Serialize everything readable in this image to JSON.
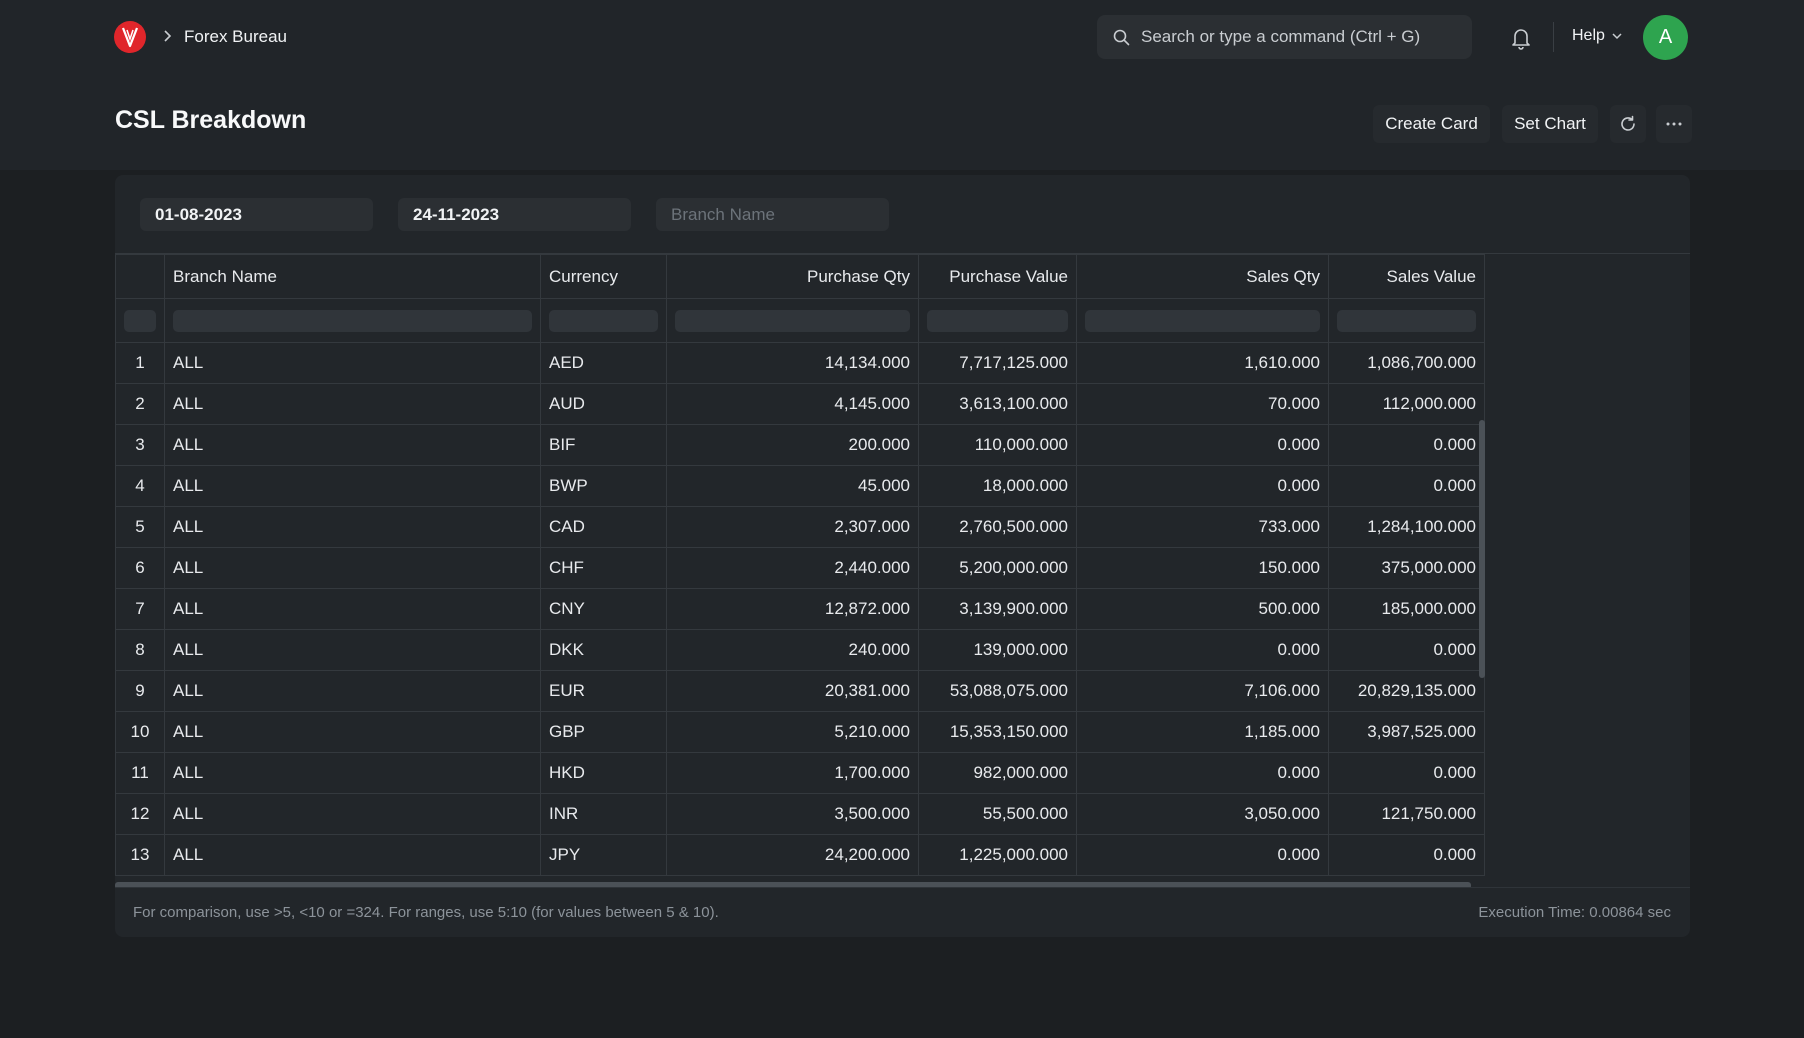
{
  "navbar": {
    "breadcrumb": "Forex Bureau",
    "search_placeholder": "Search or type a command (Ctrl + G)",
    "help_label": "Help",
    "avatar_letter": "A"
  },
  "page": {
    "title": "CSL Breakdown",
    "actions": {
      "create_card": "Create Card",
      "set_chart": "Set Chart"
    }
  },
  "filters": {
    "from_date": "01-08-2023",
    "to_date": "24-11-2023",
    "branch_placeholder": "Branch Name"
  },
  "table": {
    "columns": [
      "Branch Name",
      "Currency",
      "Purchase Qty",
      "Purchase Value",
      "Sales Qty",
      "Sales Value"
    ],
    "rows": [
      {
        "idx": "1",
        "branch": "ALL",
        "currency": "AED",
        "purchase_qty": "14,134.000",
        "purchase_value": "7,717,125.000",
        "sales_qty": "1,610.000",
        "sales_value": "1,086,700.000"
      },
      {
        "idx": "2",
        "branch": "ALL",
        "currency": "AUD",
        "purchase_qty": "4,145.000",
        "purchase_value": "3,613,100.000",
        "sales_qty": "70.000",
        "sales_value": "112,000.000"
      },
      {
        "idx": "3",
        "branch": "ALL",
        "currency": "BIF",
        "purchase_qty": "200.000",
        "purchase_value": "110,000.000",
        "sales_qty": "0.000",
        "sales_value": "0.000"
      },
      {
        "idx": "4",
        "branch": "ALL",
        "currency": "BWP",
        "purchase_qty": "45.000",
        "purchase_value": "18,000.000",
        "sales_qty": "0.000",
        "sales_value": "0.000"
      },
      {
        "idx": "5",
        "branch": "ALL",
        "currency": "CAD",
        "purchase_qty": "2,307.000",
        "purchase_value": "2,760,500.000",
        "sales_qty": "733.000",
        "sales_value": "1,284,100.000"
      },
      {
        "idx": "6",
        "branch": "ALL",
        "currency": "CHF",
        "purchase_qty": "2,440.000",
        "purchase_value": "5,200,000.000",
        "sales_qty": "150.000",
        "sales_value": "375,000.000"
      },
      {
        "idx": "7",
        "branch": "ALL",
        "currency": "CNY",
        "purchase_qty": "12,872.000",
        "purchase_value": "3,139,900.000",
        "sales_qty": "500.000",
        "sales_value": "185,000.000"
      },
      {
        "idx": "8",
        "branch": "ALL",
        "currency": "DKK",
        "purchase_qty": "240.000",
        "purchase_value": "139,000.000",
        "sales_qty": "0.000",
        "sales_value": "0.000"
      },
      {
        "idx": "9",
        "branch": "ALL",
        "currency": "EUR",
        "purchase_qty": "20,381.000",
        "purchase_value": "53,088,075.000",
        "sales_qty": "7,106.000",
        "sales_value": "20,829,135.000"
      },
      {
        "idx": "10",
        "branch": "ALL",
        "currency": "GBP",
        "purchase_qty": "5,210.000",
        "purchase_value": "15,353,150.000",
        "sales_qty": "1,185.000",
        "sales_value": "3,987,525.000"
      },
      {
        "idx": "11",
        "branch": "ALL",
        "currency": "HKD",
        "purchase_qty": "1,700.000",
        "purchase_value": "982,000.000",
        "sales_qty": "0.000",
        "sales_value": "0.000"
      },
      {
        "idx": "12",
        "branch": "ALL",
        "currency": "INR",
        "purchase_qty": "3,500.000",
        "purchase_value": "55,500.000",
        "sales_qty": "3,050.000",
        "sales_value": "121,750.000"
      },
      {
        "idx": "13",
        "branch": "ALL",
        "currency": "JPY",
        "purchase_qty": "24,200.000",
        "purchase_value": "1,225,000.000",
        "sales_qty": "0.000",
        "sales_value": "0.000"
      }
    ]
  },
  "footer": {
    "hint": "For comparison, use >5, <10 or =324. For ranges, use 5:10 (for values between 5 & 10).",
    "execution_time": "Execution Time: 0.00864 sec"
  },
  "icons": {
    "logo": "brand-logo-icon",
    "breadcrumb_separator": "chevron-right-icon",
    "search": "search-icon",
    "notifications": "bell-icon",
    "help_dropdown": "chevron-down-icon",
    "refresh": "refresh-icon",
    "more": "ellipsis-icon"
  },
  "colors": {
    "background": "#1c1f22",
    "surface": "#212529",
    "avatar": "#2ea44f",
    "logo": "#e0262b"
  }
}
